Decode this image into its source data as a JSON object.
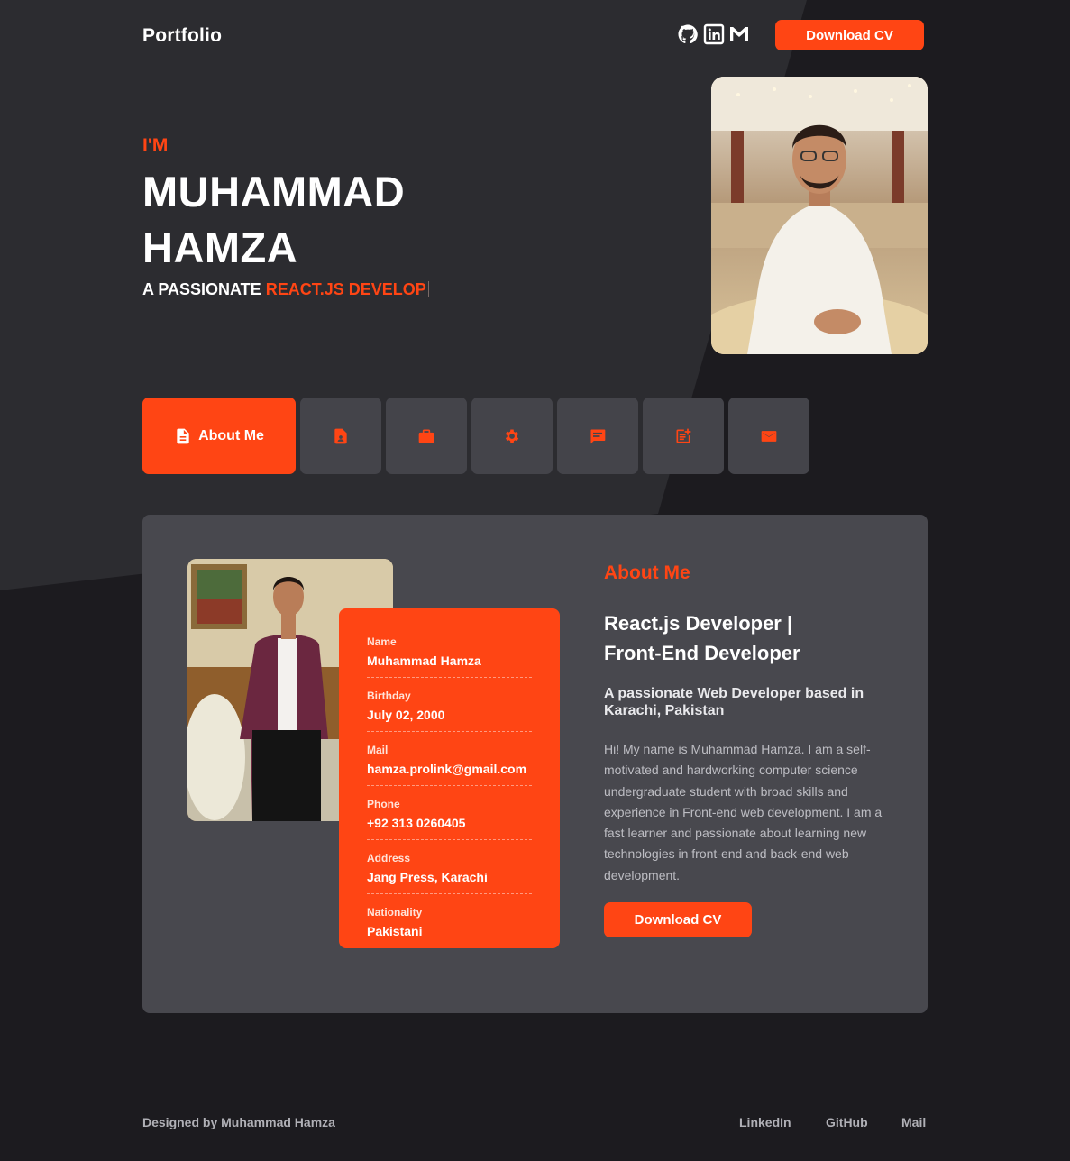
{
  "nav": {
    "brand": "Portfolio",
    "social_icons": [
      "github-icon",
      "linkedin-icon",
      "gmail-icon"
    ],
    "cta_label": "Download CV"
  },
  "hero": {
    "intro": "I'M",
    "name_line1": "MUHAMMAD",
    "name_line2": "HAMZA",
    "subtitle_prefix": "A PASSIONATE",
    "subtitle_typed": "REACT.JS DEVELOP",
    "photo_alt": "Portrait photo"
  },
  "tabs": {
    "active_label": "About Me",
    "items": [
      {
        "icon": "document-icon",
        "label": "About Me"
      },
      {
        "icon": "resume-icon"
      },
      {
        "icon": "briefcase-icon"
      },
      {
        "icon": "gear-icon"
      },
      {
        "icon": "chat-icon"
      },
      {
        "icon": "post-add-icon"
      },
      {
        "icon": "mail-icon"
      }
    ]
  },
  "about": {
    "section_title": "About Me",
    "role_line1": "React.js Developer |",
    "role_line2": "Front-End Developer",
    "tagline": "A passionate Web Developer based in Karachi, Pakistan",
    "bio": "Hi! My name is Muhammad Hamza. I am a self-motivated and hardworking computer science undergraduate student with broad skills and experience in Front-end web development. I am a fast learner and passionate about learning new technologies in front-end and back-end web development.",
    "cta_label": "Download CV",
    "info": [
      {
        "label": "Name",
        "value": "Muhammad Hamza"
      },
      {
        "label": "Birthday",
        "value": "July 02, 2000"
      },
      {
        "label": "Mail",
        "value": "hamza.prolink@gmail.com"
      },
      {
        "label": "Phone",
        "value": "+92 313 0260405"
      },
      {
        "label": "Address",
        "value": "Jang Press, Karachi"
      },
      {
        "label": "Nationality",
        "value": "Pakistani"
      }
    ]
  },
  "footer": {
    "credit": "Designed by Muhammad Hamza",
    "links": [
      "LinkedIn",
      "GitHub",
      "Mail"
    ]
  },
  "colors": {
    "accent": "#ff4514",
    "background": "#1c1b1f",
    "surface": "#48484e",
    "tab": "#44444a"
  }
}
